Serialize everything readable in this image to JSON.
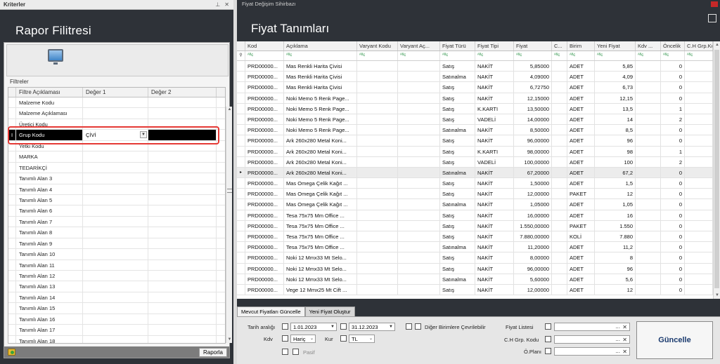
{
  "left_panel": {
    "window_title": "Kriterler",
    "pin_symbol": "⊥",
    "close_symbol": "✕",
    "header": "Rapor Filitresi",
    "filters_label": "Filtreler",
    "columns": [
      "Filtre Açıklaması",
      "Değer 1",
      "Değer 2"
    ],
    "rows": [
      {
        "name": "Malzeme Kodu",
        "v1": "",
        "v2": ""
      },
      {
        "name": "Malzeme Açıklaması",
        "v1": "",
        "v2": ""
      },
      {
        "name": "Üretici Kodu",
        "v1": "",
        "v2": ""
      },
      {
        "name": "Grup Kodu",
        "v1": "ÇİVİ",
        "v2": ""
      },
      {
        "name": "Yetki Kodu",
        "v1": "",
        "v2": ""
      },
      {
        "name": "MARKA",
        "v1": "",
        "v2": ""
      },
      {
        "name": "TEDARİKÇİ",
        "v1": "",
        "v2": ""
      },
      {
        "name": "Tanımlı Alan 3",
        "v1": "",
        "v2": ""
      },
      {
        "name": "Tanımlı Alan 4",
        "v1": "",
        "v2": ""
      },
      {
        "name": "Tanımlı Alan 5",
        "v1": "",
        "v2": ""
      },
      {
        "name": "Tanımlı Alan 6",
        "v1": "",
        "v2": ""
      },
      {
        "name": "Tanımlı Alan 7",
        "v1": "",
        "v2": ""
      },
      {
        "name": "Tanımlı Alan 8",
        "v1": "",
        "v2": ""
      },
      {
        "name": "Tanımlı Alan 9",
        "v1": "",
        "v2": ""
      },
      {
        "name": "Tanımlı Alan 10",
        "v1": "",
        "v2": ""
      },
      {
        "name": "Tanımlı Alan 11",
        "v1": "",
        "v2": ""
      },
      {
        "name": "Tanımlı Alan 12",
        "v1": "",
        "v2": ""
      },
      {
        "name": "Tanımlı Alan 13",
        "v1": "",
        "v2": ""
      },
      {
        "name": "Tanımlı Alan 14",
        "v1": "",
        "v2": ""
      },
      {
        "name": "Tanımlı Alan 15",
        "v1": "",
        "v2": ""
      },
      {
        "name": "Tanımlı Alan 16",
        "v1": "",
        "v2": ""
      },
      {
        "name": "Tanımlı Alan 17",
        "v1": "",
        "v2": ""
      },
      {
        "name": "Tanımlı Alan 18",
        "v1": "",
        "v2": ""
      }
    ],
    "selected_row_index": 3,
    "report_button": "Raporla"
  },
  "right_panel": {
    "window_title": "Fiyat Değişim Sihirbazı",
    "header": "Fiyat Tanımları",
    "filter_placeholder": "ᴬᴮc",
    "columns": [
      "Kod",
      "Açıklama",
      "Varyant Kodu",
      "Varyant Aç...",
      "Fiyat Türü",
      "Fiyat Tipi",
      "Fiyat",
      "C...",
      "Birim",
      "Yeni Fiyat",
      "Kdv ...",
      "Öncelik",
      "C.H Grp.Ko..."
    ],
    "rows": [
      {
        "kod": "PRD00000...",
        "aciklama": "Mas Renkli Harita Çivisi",
        "tur": "Satış",
        "tip": "NAKİT",
        "fiyat": "5,85000",
        "birim": "ADET",
        "yeni": "5,85",
        "oncelik": "0"
      },
      {
        "kod": "PRD00000...",
        "aciklama": "Mas Renkli Harita Çivisi",
        "tur": "Satınalma",
        "tip": "NAKİT",
        "fiyat": "4,09000",
        "birim": "ADET",
        "yeni": "4,09",
        "oncelik": "0"
      },
      {
        "kod": "PRD00000...",
        "aciklama": "Mas Renkli Harita Çivisi",
        "tur": "Satış",
        "tip": "NAKİT",
        "fiyat": "6,72750",
        "birim": "ADET",
        "yeni": "6,73",
        "oncelik": "0"
      },
      {
        "kod": "PRD00000...",
        "aciklama": "Noki Memo 5 Renk Page...",
        "tur": "Satış",
        "tip": "NAKİT",
        "fiyat": "12,15000",
        "birim": "ADET",
        "yeni": "12,15",
        "oncelik": "0"
      },
      {
        "kod": "PRD00000...",
        "aciklama": "Noki Memo 5 Renk Page...",
        "tur": "Satış",
        "tip": "K.KARTI",
        "fiyat": "13,50000",
        "birim": "ADET",
        "yeni": "13,5",
        "oncelik": "1"
      },
      {
        "kod": "PRD00000...",
        "aciklama": "Noki Memo 5 Renk Page...",
        "tur": "Satış",
        "tip": "VADELİ",
        "fiyat": "14,00000",
        "birim": "ADET",
        "yeni": "14",
        "oncelik": "2"
      },
      {
        "kod": "PRD00000...",
        "aciklama": "Noki Memo 5 Renk Page...",
        "tur": "Satınalma",
        "tip": "NAKİT",
        "fiyat": "8,50000",
        "birim": "ADET",
        "yeni": "8,5",
        "oncelik": "0"
      },
      {
        "kod": "PRD00000...",
        "aciklama": "Ark 260x280 Metal Koni...",
        "tur": "Satış",
        "tip": "NAKİT",
        "fiyat": "96,00000",
        "birim": "ADET",
        "yeni": "96",
        "oncelik": "0"
      },
      {
        "kod": "PRD00000...",
        "aciklama": "Ark 260x280 Metal Koni...",
        "tur": "Satış",
        "tip": "K.KARTI",
        "fiyat": "98,00000",
        "birim": "ADET",
        "yeni": "98",
        "oncelik": "1"
      },
      {
        "kod": "PRD00000...",
        "aciklama": "Ark 260x280 Metal Koni...",
        "tur": "Satış",
        "tip": "VADELİ",
        "fiyat": "100,00000",
        "birim": "ADET",
        "yeni": "100",
        "oncelik": "2"
      },
      {
        "kod": "PRD00000...",
        "aciklama": "Ark 260x280 Metal Koni...",
        "tur": "Satınalma",
        "tip": "NAKİT",
        "fiyat": "67,20000",
        "birim": "ADET",
        "yeni": "67,2",
        "oncelik": "0"
      },
      {
        "kod": "PRD00000...",
        "aciklama": "Mas Omega Çelik Kağıt ...",
        "tur": "Satış",
        "tip": "NAKİT",
        "fiyat": "1,50000",
        "birim": "ADET",
        "yeni": "1,5",
        "oncelik": "0"
      },
      {
        "kod": "PRD00000...",
        "aciklama": "Mas Omega Çelik Kağıt ...",
        "tur": "Satış",
        "tip": "NAKİT",
        "fiyat": "12,00000",
        "birim": "PAKET",
        "yeni": "12",
        "oncelik": "0"
      },
      {
        "kod": "PRD00000...",
        "aciklama": "Mas Omega Çelik Kağıt ...",
        "tur": "Satınalma",
        "tip": "NAKİT",
        "fiyat": "1,05000",
        "birim": "ADET",
        "yeni": "1,05",
        "oncelik": "0"
      },
      {
        "kod": "PRD00000...",
        "aciklama": "Tesa 75x75 Mm Office ...",
        "tur": "Satış",
        "tip": "NAKİT",
        "fiyat": "16,00000",
        "birim": "ADET",
        "yeni": "16",
        "oncelik": "0"
      },
      {
        "kod": "PRD00000...",
        "aciklama": "Tesa 75x75 Mm Office ...",
        "tur": "Satış",
        "tip": "NAKİT",
        "fiyat": "1.550,00000",
        "birim": "PAKET",
        "yeni": "1.550",
        "oncelik": "0"
      },
      {
        "kod": "PRD00000...",
        "aciklama": "Tesa 75x75 Mm Office ...",
        "tur": "Satış",
        "tip": "NAKİT",
        "fiyat": "7.880,00000",
        "birim": "KOLİ",
        "yeni": "7.880",
        "oncelik": "0"
      },
      {
        "kod": "PRD00000...",
        "aciklama": "Tesa 75x75 Mm Office ...",
        "tur": "Satınalma",
        "tip": "NAKİT",
        "fiyat": "11,20000",
        "birim": "ADET",
        "yeni": "11,2",
        "oncelik": "0"
      },
      {
        "kod": "PRD00000...",
        "aciklama": "Noki 12 Mmx33 Mt Selo...",
        "tur": "Satış",
        "tip": "NAKİT",
        "fiyat": "8,00000",
        "birim": "ADET",
        "yeni": "8",
        "oncelik": "0"
      },
      {
        "kod": "PRD00000...",
        "aciklama": "Noki 12 Mmx33 Mt Selo...",
        "tur": "Satış",
        "tip": "NAKİT",
        "fiyat": "96,00000",
        "birim": "ADET",
        "yeni": "96",
        "oncelik": "0"
      },
      {
        "kod": "PRD00000...",
        "aciklama": "Noki 12 Mmx33 Mt Selo...",
        "tur": "Satınalma",
        "tip": "NAKİT",
        "fiyat": "5,60000",
        "birim": "ADET",
        "yeni": "5,6",
        "oncelik": "0"
      },
      {
        "kod": "PRD00000...",
        "aciklama": "Vege 12 Mmx25 Mt Cift ...",
        "tur": "Satış",
        "tip": "NAKİT",
        "fiyat": "12,00000",
        "birim": "ADET",
        "yeni": "12",
        "oncelik": "0"
      }
    ],
    "active_row_index": 10,
    "tabs": [
      {
        "label": "Mevcut Fiyatları Güncelle",
        "active": true
      },
      {
        "label": "Yeni Fiyat Oluştur",
        "active": false
      }
    ],
    "form": {
      "tarih_label": "Tarih aralığı",
      "date_from": "1.01.2023",
      "date_to": "31.12.2023",
      "diger_label": "Diğer Birimlere Çevrilebilir",
      "kdv_label": "Kdv",
      "kdv_value": "Hariç",
      "kur_label": "Kur",
      "kur_value": "TL",
      "pasif_label": "Pasif",
      "fiyat_listesi_label": "Fiyat Listesi",
      "ch_grp_label": "C.H Grp. Kodu",
      "oplani_label": "Ö.Planı",
      "lookup_dots": "...",
      "lookup_clear": "✕",
      "update_button": "Güncelle"
    }
  },
  "colors": {
    "dark_bg": "#2e3238",
    "highlight_border": "#e53935",
    "update_text": "#1a3a6e",
    "filter_icon": "#1b8a3a"
  }
}
